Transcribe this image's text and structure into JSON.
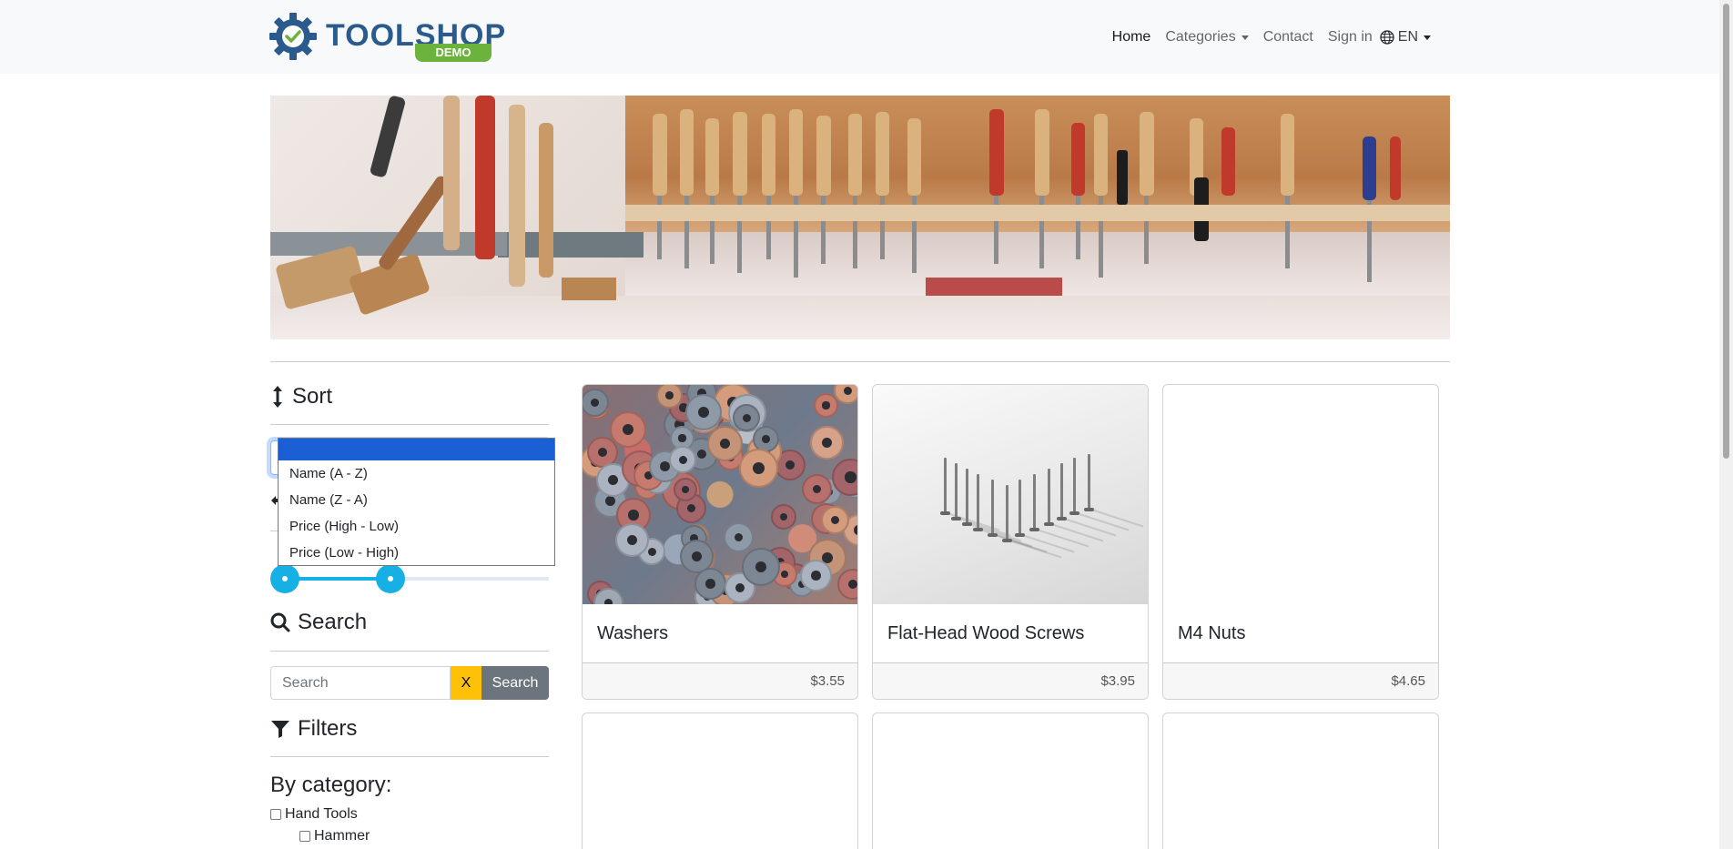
{
  "brand": {
    "word_left": "TOOL",
    "word_right": "SHOP",
    "badge": "DEMO"
  },
  "nav": {
    "home": "Home",
    "categories": "Categories",
    "contact": "Contact",
    "signin": "Sign in",
    "language": "EN"
  },
  "sidebar": {
    "sort_heading": "Sort",
    "sort_options": [
      "",
      "Name (A - Z)",
      "Name (Z - A)",
      "Price (High - Low)",
      "Price (Low - High)"
    ],
    "price_range": {
      "min_fraction": 0.0,
      "max_fraction": 0.4
    },
    "search_heading": "Search",
    "search_placeholder": "Search",
    "clear_label": "X",
    "search_button": "Search",
    "filters_heading": "Filters",
    "by_category": "By category:",
    "categories": [
      {
        "label": "Hand Tools",
        "level": 0
      },
      {
        "label": "Hammer",
        "level": 1
      }
    ]
  },
  "products": [
    {
      "name": "Washers",
      "price": "$3.55",
      "image": "washers"
    },
    {
      "name": "Flat-Head Wood Screws",
      "price": "$3.95",
      "image": "screws"
    },
    {
      "name": "M4 Nuts",
      "price": "$4.65",
      "image": "blank"
    }
  ],
  "colors": {
    "accent": "#17b0e5",
    "select_highlight": "#1a5fd4",
    "clear_button": "#ffc107",
    "search_button": "#6c757d",
    "brand_blue": "#2a5b8c",
    "brand_green": "#6cb33e"
  }
}
